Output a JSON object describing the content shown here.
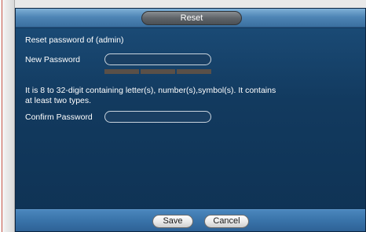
{
  "dialog": {
    "title": "Reset",
    "reset_label": "Reset password of (admin)",
    "new_password_label": "New Password",
    "new_password_value": "",
    "password_hint": "It is 8 to 32-digit containing letter(s), number(s),symbol(s). It contains at least two types.",
    "confirm_password_label": "Confirm Password",
    "confirm_password_value": "",
    "strength_segments": 3,
    "strength_level": 0
  },
  "footer": {
    "save_label": "Save",
    "cancel_label": "Cancel"
  },
  "colors": {
    "panel_bg": "#123a5f",
    "titlebar": "#4f86b6",
    "strength_bar": "#5a5048"
  }
}
